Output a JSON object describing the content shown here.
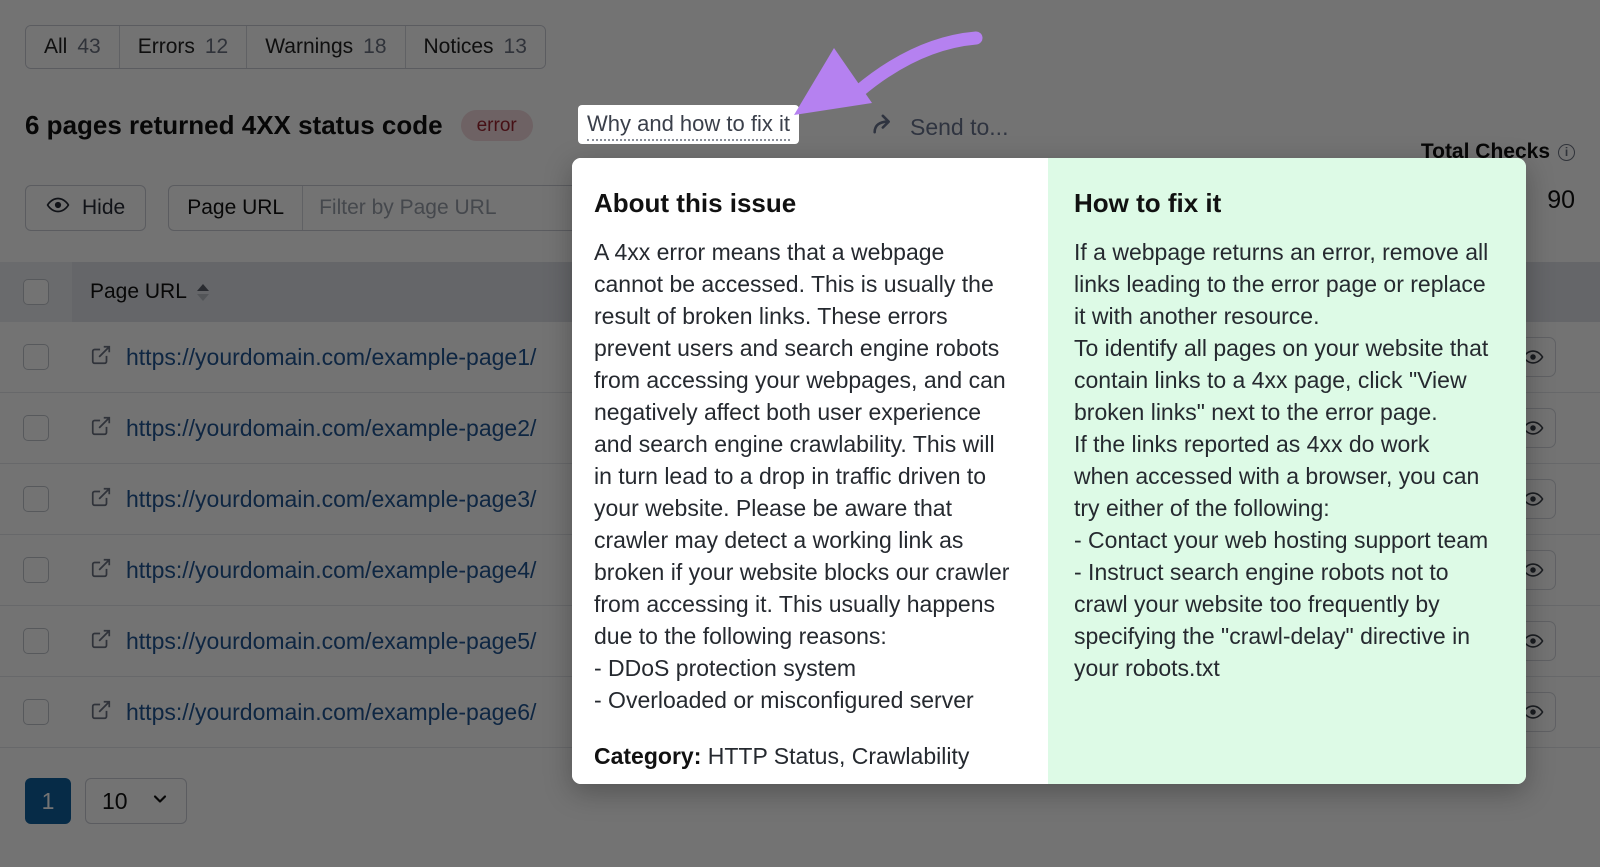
{
  "tabs": [
    {
      "label": "All",
      "count": "43"
    },
    {
      "label": "Errors",
      "count": "12"
    },
    {
      "label": "Warnings",
      "count": "18"
    },
    {
      "label": "Notices",
      "count": "13"
    }
  ],
  "issue": {
    "title": "6 pages returned 4XX status code",
    "severity_badge": "error",
    "why_link": "Why and how to fix it",
    "send_to": "Send to...",
    "send_to_icon": "share-arrow-icon"
  },
  "filters": {
    "hide_label": "Hide",
    "hide_icon": "eye-icon",
    "filter_key": "Page URL",
    "filter_placeholder": "Filter by Page URL",
    "filter_value": ""
  },
  "total_checks": {
    "label": "Total Checks",
    "info_icon": "info-icon",
    "value": "90"
  },
  "table": {
    "columns": [
      "Page URL"
    ],
    "sort_icon": "sort-caret-icon",
    "row_icon": "external-link-icon",
    "row_action_icon": "eye-icon",
    "rows": [
      {
        "url": "https://yourdomain.com/example-page1/"
      },
      {
        "url": "https://yourdomain.com/example-page2/"
      },
      {
        "url": "https://yourdomain.com/example-page3/"
      },
      {
        "url": "https://yourdomain.com/example-page4/"
      },
      {
        "url": "https://yourdomain.com/example-page5/"
      },
      {
        "url": "https://yourdomain.com/example-page6/"
      }
    ]
  },
  "pagination": {
    "current_page": "1",
    "page_size": "10",
    "chevron_icon": "chevron-down-icon"
  },
  "popover": {
    "about": {
      "heading": "About this issue",
      "body": "A 4xx error means that a webpage cannot be accessed. This is usually the result of broken links. These errors prevent users and search engine robots from accessing your webpages, and can negatively affect both user experience and search engine crawlability. This will in turn lead to a drop in traffic driven to your website. Please be aware that crawler may detect a working link as broken if your website blocks our crawler from accessing it. This usually happens due to the following reasons:\n- DDoS protection system\n- Overloaded or misconfigured server",
      "category_label": "Category:",
      "category_value": "HTTP Status, Crawlability"
    },
    "fix": {
      "heading": "How to fix it",
      "body": "If a webpage returns an error, remove all links leading to the error page or replace it with another resource.\nTo identify all pages on your website that contain links to a 4xx page, click \"View broken links\" next to the error page.\nIf the links reported as 4xx do work when accessed with a browser, you can try either of the following:\n- Contact your web hosting support team\n- Instruct search engine robots not to crawl your website too frequently by specifying the \"crawl-delay\" directive in your robots.txt"
    }
  },
  "annotation": {
    "arrow_icon": "curved-arrow-annotation",
    "arrow_color": "#b581f0"
  },
  "colors": {
    "accent_blue": "#0e5f9e",
    "link_blue": "#1f5493",
    "error_badge_bg": "#f3d9dd",
    "error_badge_text": "#9b2430",
    "fix_panel_bg": "#ddfae6",
    "overlay": "rgba(0,0,0,0.55)"
  }
}
